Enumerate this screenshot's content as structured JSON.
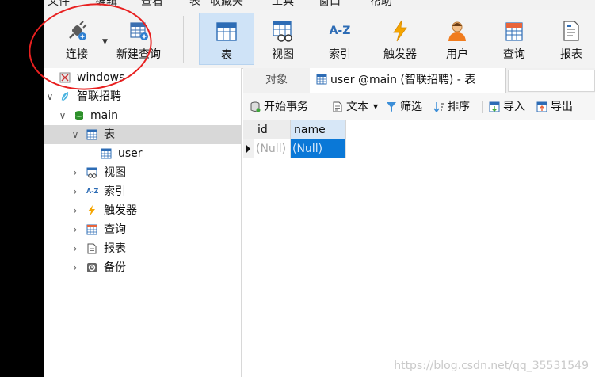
{
  "menu": [
    "文件",
    "编辑",
    "查看",
    "表",
    "收藏夹",
    "工具",
    "窗口",
    "帮助"
  ],
  "toolbar": {
    "connect": "连接",
    "new_query": "新建查询",
    "table": "表",
    "view": "视图",
    "index": "索引",
    "trigger": "触发器",
    "user": "用户",
    "query": "查询",
    "report": "报表"
  },
  "index_icon_text": "A-Z",
  "nav": {
    "conn_windows": "windows",
    "conn_zhilian": "智联招聘",
    "db_main": "main",
    "tables": "表",
    "table_user": "user",
    "views": "视图",
    "indexes": "索引",
    "triggers": "触发器",
    "queries": "查询",
    "reports": "报表",
    "backups": "备份"
  },
  "tabs": {
    "objects": "对象",
    "user_tab": "user @main (智联招聘) - 表"
  },
  "subtoolbar": {
    "begin_transaction": "开始事务",
    "text": "文本",
    "filter": "筛选",
    "sort": "排序",
    "import": "导入",
    "export": "导出"
  },
  "grid": {
    "columns": [
      "id",
      "name"
    ],
    "row": [
      "(Null)",
      "(Null)"
    ]
  },
  "watermark": "https://blog.csdn.net/qq_35531549",
  "colors": {
    "selection": "#0a78d7",
    "active_tool": "#cfe3f7",
    "annotation": "#e82020"
  }
}
